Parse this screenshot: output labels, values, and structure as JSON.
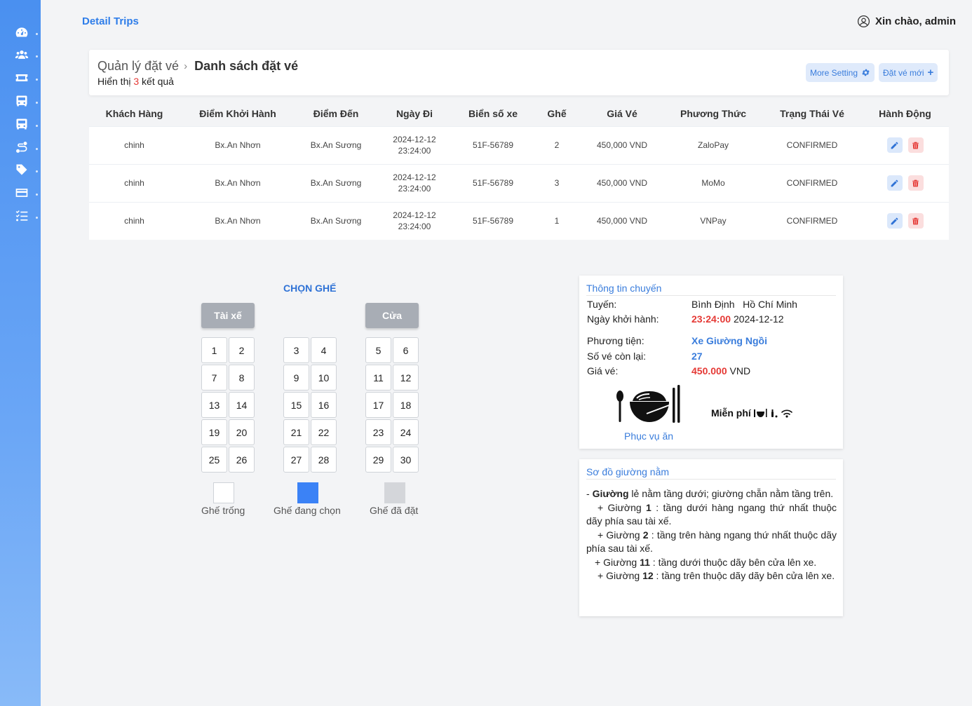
{
  "header": {
    "breadcrumb": "Detail Trips",
    "greeting": "Xin chào, admin"
  },
  "sidebar": {
    "icons": [
      "dashboard-icon",
      "users-icon",
      "ticket-icon",
      "bus-icon",
      "bus-icon",
      "route-icon",
      "tag-icon",
      "card-icon",
      "list-icon"
    ]
  },
  "title_card": {
    "parent": "Quản lý đặt vé",
    "current": "Danh sách đặt vé",
    "result_prefix": "Hiển thị",
    "result_count": "3",
    "result_suffix": "kết quả",
    "more_setting": "More Setting",
    "new_booking": "Đặt vé mới"
  },
  "table": {
    "headers": [
      "Khách Hàng",
      "Điểm Khởi Hành",
      "Điểm Đến",
      "Ngày Đi",
      "Biển số xe",
      "Ghế",
      "Giá Vé",
      "Phương Thức",
      "Trạng Thái Vé",
      "Hành Động"
    ],
    "rows": [
      {
        "customer": "chinh",
        "from": "Bx.An Nhơn",
        "to": "Bx.An Sương",
        "date": "2024-12-12",
        "time": "23:24:00",
        "plate": "51F-56789",
        "seat": "2",
        "price": "450,000 VND",
        "method": "ZaloPay",
        "status": "CONFIRMED"
      },
      {
        "customer": "chinh",
        "from": "Bx.An Nhơn",
        "to": "Bx.An Sương",
        "date": "2024-12-12",
        "time": "23:24:00",
        "plate": "51F-56789",
        "seat": "3",
        "price": "450,000 VND",
        "method": "MoMo",
        "status": "CONFIRMED"
      },
      {
        "customer": "chinh",
        "from": "Bx.An Nhơn",
        "to": "Bx.An Sương",
        "date": "2024-12-12",
        "time": "23:24:00",
        "plate": "51F-56789",
        "seat": "1",
        "price": "450,000 VND",
        "method": "VNPay",
        "status": "CONFIRMED"
      }
    ]
  },
  "seat_map": {
    "title": "CHỌN GHẾ",
    "driver_label": "Tài xế",
    "door_label": "Cửa",
    "groups": [
      [
        [
          "1",
          "2"
        ],
        [
          "7",
          "8"
        ],
        [
          "13",
          "14"
        ],
        [
          "19",
          "20"
        ],
        [
          "25",
          "26"
        ]
      ],
      [
        [
          "3",
          "4"
        ],
        [
          "9",
          "10"
        ],
        [
          "15",
          "16"
        ],
        [
          "21",
          "22"
        ],
        [
          "27",
          "28"
        ]
      ],
      [
        [
          "5",
          "6"
        ],
        [
          "11",
          "12"
        ],
        [
          "17",
          "18"
        ],
        [
          "23",
          "24"
        ],
        [
          "29",
          "30"
        ]
      ]
    ],
    "legend": [
      {
        "label": "Ghế trống",
        "color": "#ffffff"
      },
      {
        "label": "Ghế đang chọn",
        "color": "#3b82f6"
      },
      {
        "label": "Ghế đã đặt",
        "color": "#d4d6da"
      }
    ]
  },
  "trip_info": {
    "title": "Thông tin chuyến",
    "route_label": "Tuyến:",
    "route_from": "Bình Định",
    "route_to": "Hồ Chí Minh",
    "depart_label": "Ngày khởi hành:",
    "depart_time": "23:24:00",
    "depart_date": "2024-12-12",
    "vehicle_label": "Phương tiện:",
    "vehicle_value": "Xe Giường Ngồi",
    "remaining_label": "Số vé còn lại:",
    "remaining_value": "27",
    "price_label": "Giá vé:",
    "price_value": "450.000",
    "price_unit": "VND",
    "meal_label": "Phục vụ ăn",
    "free_label": "Miễn phí"
  },
  "bed_map": {
    "title": "Sơ đồ giường nằm",
    "intro_prefix": "- ",
    "intro_bold": "Giường",
    "intro_text": " lẻ nằm tầng dưới; giường chẵn nằm tầng trên.",
    "items": [
      {
        "prefix": "+ Giường ",
        "num": "1",
        "text": " : tầng dưới hàng ngang thứ nhất thuộc dãy phía sau tài xế."
      },
      {
        "prefix": "+ Giường ",
        "num": "2",
        "text": " : tầng trên hàng ngang thứ nhất thuộc dãy phía sau tài xế."
      },
      {
        "prefix": "+ Giường ",
        "num": "11",
        "text": " : tầng dưới thuộc dãy bên cửa lên xe."
      },
      {
        "prefix": "+ Giường ",
        "num": "12",
        "text": " : tầng trên thuộc dãy dãy bên cửa lên xe."
      }
    ]
  }
}
